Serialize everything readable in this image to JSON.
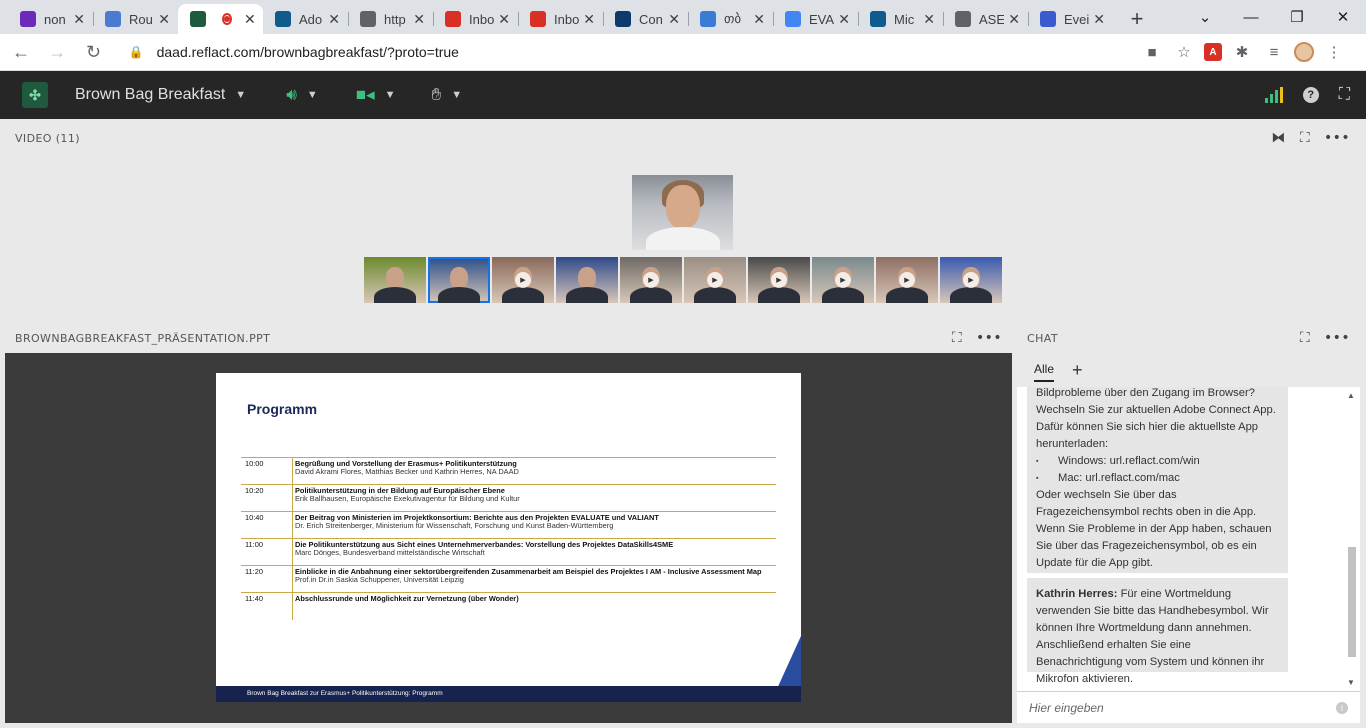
{
  "browser": {
    "tabs": [
      {
        "title": "non",
        "icon": "mail-icon",
        "color": "#6b2bb8"
      },
      {
        "title": "Rou",
        "icon": "route-icon",
        "color": "#4a7bd0"
      },
      {
        "title": "",
        "icon": "connect-icon",
        "color": "#1f5a3f",
        "active": true,
        "recording": true
      },
      {
        "title": "Ado",
        "icon": "d-icon",
        "color": "#0f5b8e"
      },
      {
        "title": "http",
        "icon": "globe-icon",
        "color": "#5f6368"
      },
      {
        "title": "Inbo",
        "icon": "gmail-icon",
        "color": "#d93025"
      },
      {
        "title": "Inbo",
        "icon": "gmail-icon",
        "color": "#d93025"
      },
      {
        "title": "Con",
        "icon": "asterisk-icon",
        "color": "#0a3b6b"
      },
      {
        "title": "თბ",
        "icon": "cloud-icon",
        "color": "#3a7bd5"
      },
      {
        "title": "EVA",
        "icon": "google-icon",
        "color": "#4285f4"
      },
      {
        "title": "Mic",
        "icon": "d-icon",
        "color": "#0f5b8e"
      },
      {
        "title": "ASE",
        "icon": "globe-icon",
        "color": "#5f6368"
      },
      {
        "title": "Evei",
        "icon": "event-icon",
        "color": "#3a5bd0"
      }
    ],
    "url": "daad.reflact.com/brownbagbreakfast/?proto=true"
  },
  "meeting": {
    "title": "Brown Bag Breakfast"
  },
  "video": {
    "header": "VIDEO (11)",
    "thumbnails": [
      {
        "name": "participant-1",
        "bg": "#6d8a2f",
        "selected": false,
        "play": false
      },
      {
        "name": "participant-2",
        "bg": "#2a4f8a",
        "selected": true,
        "play": false
      },
      {
        "name": "participant-3",
        "bg": "#8a6a5a",
        "selected": false,
        "play": true
      },
      {
        "name": "participant-4",
        "bg": "#2f4a8a",
        "selected": false,
        "play": false
      },
      {
        "name": "participant-5",
        "bg": "#6f6a66",
        "selected": false,
        "play": true
      },
      {
        "name": "participant-6",
        "bg": "#9a8e84",
        "selected": false,
        "play": true
      },
      {
        "name": "participant-7",
        "bg": "#4a4a4a",
        "selected": false,
        "play": true
      },
      {
        "name": "participant-8",
        "bg": "#7a8a8e",
        "selected": false,
        "play": true
      },
      {
        "name": "participant-9",
        "bg": "#8e6f64",
        "selected": false,
        "play": true
      },
      {
        "name": "participant-10",
        "bg": "#3a5ab0",
        "selected": false,
        "play": true
      }
    ]
  },
  "presentation": {
    "header": "BROWNBAGBREAKFAST_PRÄSENTATION.PPT",
    "slide": {
      "title": "Programm",
      "rows": [
        {
          "time": "10:00",
          "title": "Begrüßung und Vorstellung der Erasmus+ Politikunterstützung",
          "sub": "David Akrami Flores, Matthias Becker und Kathrin Herres, NA DAAD"
        },
        {
          "time": "10:20",
          "title": "Politikunterstützung in der Bildung auf Europäischer Ebene",
          "sub": "Erik Ballhausen, Europäische Exekutivagentur für Bildung und Kultur"
        },
        {
          "time": "10:40",
          "title": "Der Beitrag von Ministerien im Projektkonsortium: Berichte aus den Projekten EVALUATE und VALIANT",
          "sub": "Dr. Erich Streitenberger, Ministerium für Wissenschaft, Forschung und Kunst Baden-Württemberg"
        },
        {
          "time": "11:00",
          "title": "Die Politikunterstützung aus Sicht eines Unternehmerverbandes: Vorstellung des Projektes DataSkills4SME",
          "sub": "Marc Dönges, Bundesverband mittelständische Wirtschaft"
        },
        {
          "time": "11:20",
          "title": "Einblicke in die Anbahnung einer sektorübergreifenden Zusammenarbeit am Beispiel des Projektes I AM - Inclusive Assessment Map",
          "sub": "Prof.in Dr.in Saskia Schuppener, Universität Leipzig"
        },
        {
          "time": "11:40",
          "title": "Abschlussrunde und Möglichkeit zur Vernetzung (über Wonder)",
          "sub": ""
        }
      ],
      "footer": "Brown Bag Breakfast zur Erasmus+ Politikunterstützung: Programm"
    }
  },
  "chat": {
    "header": "CHAT",
    "tab": "Alle",
    "message1": {
      "line0": "Bildprobleme über den Zugang im Browser?",
      "text": "Wechseln Sie zur aktuellen Adobe Connect App. Dafür können Sie sich hier die aktuellste App herunterladen:",
      "bullet1": "Windows: url.reflact.com/win",
      "bullet2": "Mac: url.reflact.com/mac",
      "text2": "Oder wechseln Sie über das Fragezeichensymbol rechts oben in die App. Wenn Sie Probleme in der App haben, schauen Sie über das Fragezeichensymbol, ob es ein Update für die App gibt."
    },
    "message2": {
      "author": "Kathrin Herres:",
      "text": "Für eine Wortmeldung verwenden Sie bitte das Handhebesymbol. Wir können Ihre Wortmeldung dann annehmen. Anschließend erhalten Sie eine Benachrichtigung vom System und können ihr Mikrofon aktivieren."
    },
    "input_placeholder": "Hier eingeben"
  }
}
